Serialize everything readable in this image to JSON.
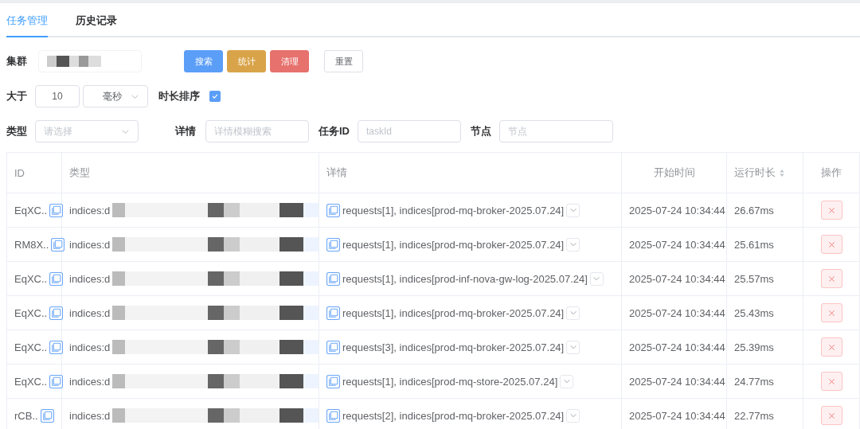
{
  "tabs": [
    {
      "label": "任务管理",
      "selected": true
    },
    {
      "label": "历史记录",
      "selected": false
    }
  ],
  "filters": {
    "cluster_label": "集群",
    "buttons": [
      {
        "label": "搜索",
        "kind": "primary"
      },
      {
        "label": "统计",
        "kind": "warning"
      },
      {
        "label": "清理",
        "kind": "danger"
      },
      {
        "label": "重置",
        "kind": "default"
      }
    ],
    "greater_label": "大于",
    "threshold": "10",
    "unit": "毫秒",
    "sort_label": "时长排序",
    "sort_checked": true,
    "type_label": "类型",
    "type_placeholder": "请选择",
    "detail_label": "详情",
    "detail_placeholder": "详情模糊搜索",
    "task_label": "任务ID",
    "task_placeholder": "taskId",
    "node_label": "节点",
    "node_placeholder": "节点"
  },
  "table": {
    "columns": [
      "ID",
      "类型",
      "详情",
      "开始时间",
      "运行时长",
      "操作"
    ],
    "rows": [
      {
        "id": "EqXC..",
        "type": "indices:d",
        "detail": "requests[1], indices[prod-mq-broker-2025.07.24]",
        "start": "2025-07-24 10:34:44",
        "duration": "26.67ms"
      },
      {
        "id": "RM8X..",
        "type": "indices:d",
        "detail": "requests[1], indices[prod-mq-broker-2025.07.24]",
        "start": "2025-07-24 10:34:44",
        "duration": "25.61ms"
      },
      {
        "id": "EqXC..",
        "type": "indices:d",
        "detail": "requests[1], indices[prod-inf-nova-gw-log-2025.07.24]",
        "start": "2025-07-24 10:34:44",
        "duration": "25.57ms"
      },
      {
        "id": "EqXC..",
        "type": "indices:d",
        "detail": "requests[1], indices[prod-mq-broker-2025.07.24]",
        "start": "2025-07-24 10:34:44",
        "duration": "25.43ms"
      },
      {
        "id": "EqXC..",
        "type": "indices:d",
        "detail": "requests[3], indices[prod-mq-broker-2025.07.24]",
        "start": "2025-07-24 10:34:44",
        "duration": "25.39ms"
      },
      {
        "id": "EqXC..",
        "type": "indices:d",
        "detail": "requests[1], indices[prod-mq-store-2025.07.24]",
        "start": "2025-07-24 10:34:44",
        "duration": "24.77ms"
      },
      {
        "id": "rCB..",
        "type": "indices:d",
        "detail": "requests[2], indices[prod-mq-broker-2025.07.24]",
        "start": "2025-07-24 10:34:44",
        "duration": "22.77ms"
      }
    ]
  }
}
